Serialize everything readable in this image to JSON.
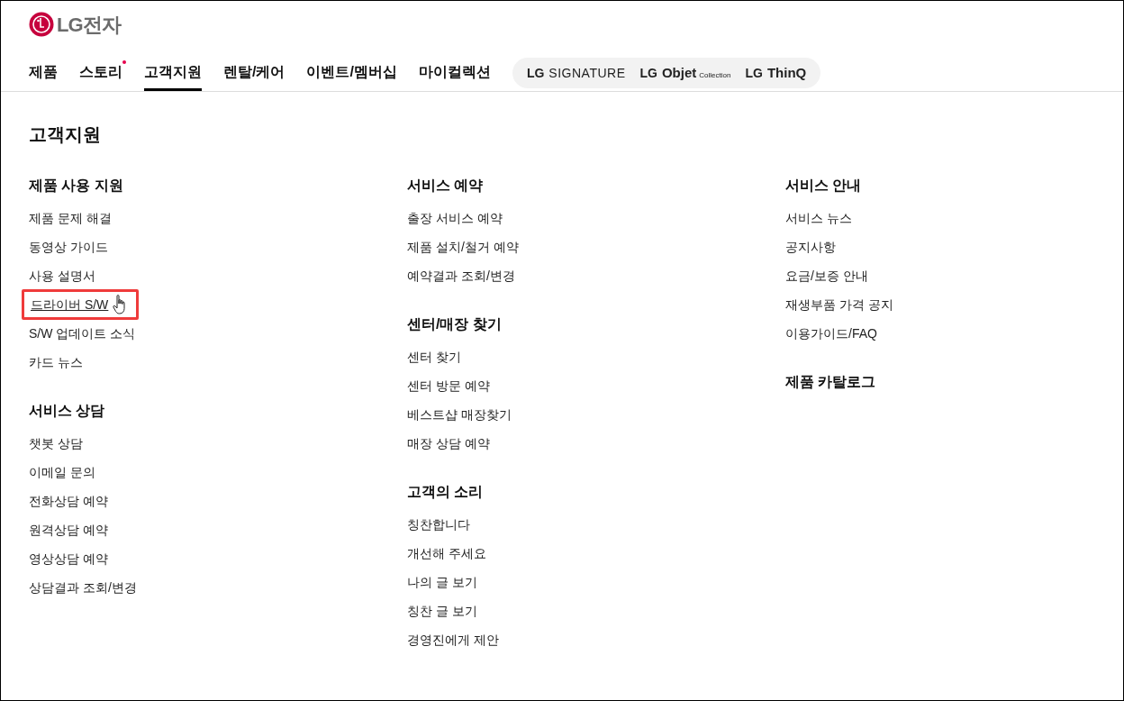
{
  "logo": {
    "text": "LG전자"
  },
  "nav": [
    {
      "label": "제품",
      "selected": false,
      "new_dot": false
    },
    {
      "label": "스토리",
      "selected": false,
      "new_dot": true
    },
    {
      "label": "고객지원",
      "selected": true,
      "new_dot": false
    },
    {
      "label": "렌탈/케어",
      "selected": false,
      "new_dot": false
    },
    {
      "label": "이벤트/멤버십",
      "selected": false,
      "new_dot": false
    },
    {
      "label": "마이컬렉션",
      "selected": false,
      "new_dot": false
    }
  ],
  "brands": [
    {
      "prefix": "LG",
      "name": "SIGNATURE",
      "kind": "thin"
    },
    {
      "prefix": "LG",
      "name": "Objet",
      "sub": "Collection",
      "kind": "regular"
    },
    {
      "prefix": "LG",
      "name": "ThinQ",
      "kind": "regular"
    }
  ],
  "page_title": "고객지원",
  "columns": [
    [
      {
        "title": "제품 사용 지원",
        "items": [
          {
            "label": "제품 문제 해결",
            "highlighted": false
          },
          {
            "label": "동영상 가이드",
            "highlighted": false
          },
          {
            "label": "사용 설명서",
            "highlighted": false
          },
          {
            "label": "드라이버 S/W",
            "highlighted": true
          },
          {
            "label": "S/W 업데이트 소식",
            "highlighted": false
          },
          {
            "label": "카드 뉴스",
            "highlighted": false
          }
        ]
      },
      {
        "title": "서비스 상담",
        "items": [
          {
            "label": "챗봇 상담",
            "highlighted": false
          },
          {
            "label": "이메일 문의",
            "highlighted": false
          },
          {
            "label": "전화상담 예약",
            "highlighted": false
          },
          {
            "label": "원격상담 예약",
            "highlighted": false
          },
          {
            "label": "영상상담 예약",
            "highlighted": false
          },
          {
            "label": "상담결과 조회/변경",
            "highlighted": false
          }
        ]
      }
    ],
    [
      {
        "title": "서비스 예약",
        "items": [
          {
            "label": "출장 서비스 예약",
            "highlighted": false
          },
          {
            "label": "제품 설치/철거 예약",
            "highlighted": false
          },
          {
            "label": "예약결과 조회/변경",
            "highlighted": false
          }
        ]
      },
      {
        "title": "센터/매장 찾기",
        "items": [
          {
            "label": "센터 찾기",
            "highlighted": false
          },
          {
            "label": "센터 방문 예약",
            "highlighted": false
          },
          {
            "label": "베스트샵 매장찾기",
            "highlighted": false
          },
          {
            "label": "매장 상담 예약",
            "highlighted": false
          }
        ]
      },
      {
        "title": "고객의 소리",
        "items": [
          {
            "label": "칭찬합니다",
            "highlighted": false
          },
          {
            "label": "개선해 주세요",
            "highlighted": false
          },
          {
            "label": "나의 글 보기",
            "highlighted": false
          },
          {
            "label": "칭찬 글 보기",
            "highlighted": false
          },
          {
            "label": "경영진에게 제안",
            "highlighted": false
          }
        ]
      }
    ],
    [
      {
        "title": "서비스 안내",
        "items": [
          {
            "label": "서비스 뉴스",
            "highlighted": false
          },
          {
            "label": "공지사항",
            "highlighted": false
          },
          {
            "label": "요금/보증 안내",
            "highlighted": false
          },
          {
            "label": "재생부품 가격 공지",
            "highlighted": false
          },
          {
            "label": "이용가이드/FAQ",
            "highlighted": false
          }
        ]
      },
      {
        "title": "제품 카탈로그"
      }
    ]
  ]
}
